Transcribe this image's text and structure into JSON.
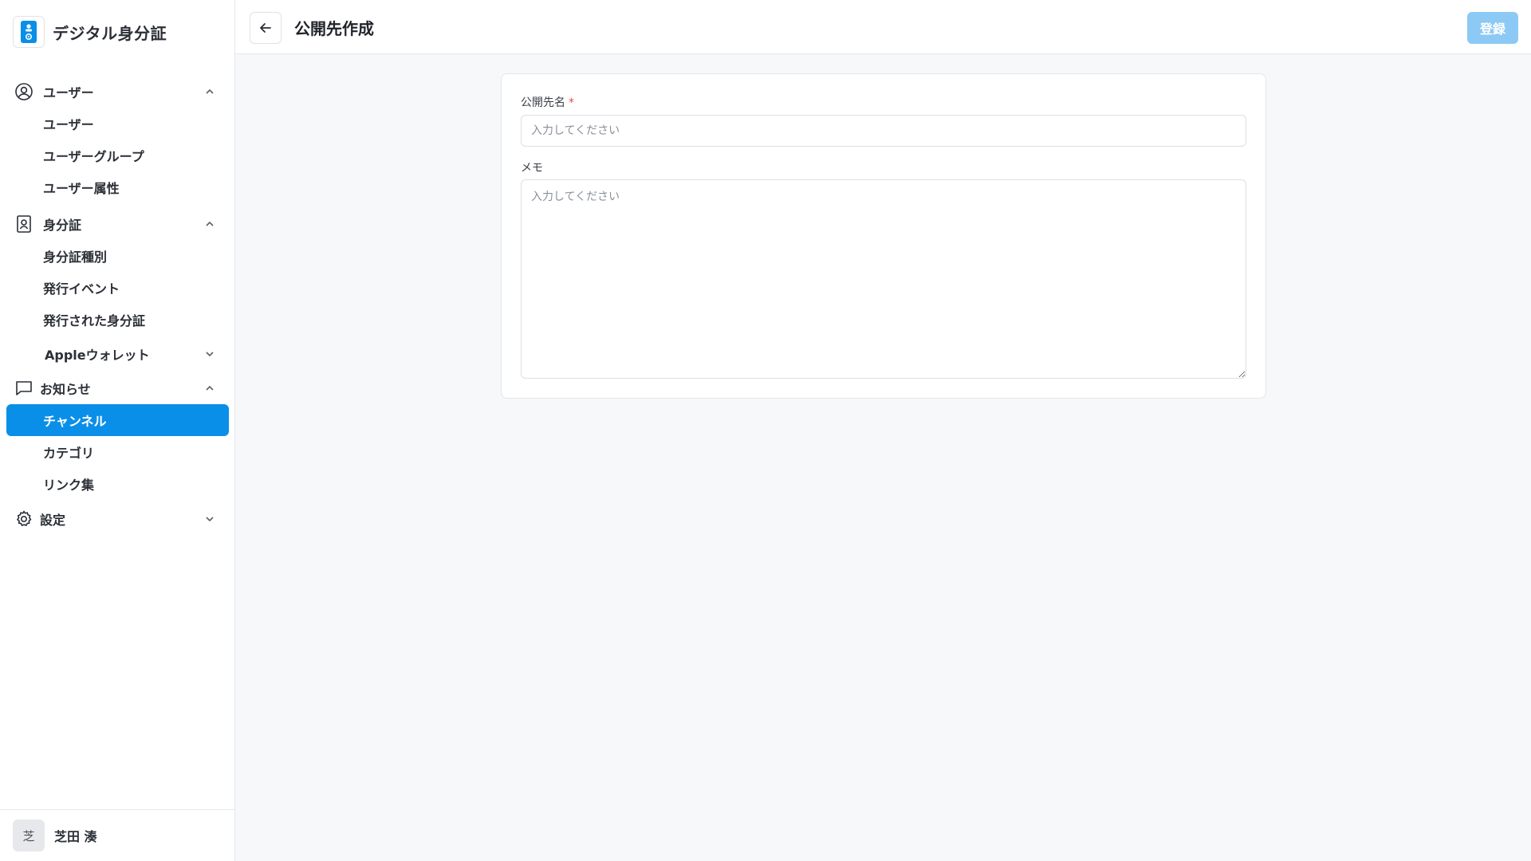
{
  "app": {
    "name": "デジタル身分証",
    "accent_color": "#0a8fe8"
  },
  "sidebar": {
    "groups": [
      {
        "label": "ユーザー",
        "icon": "user-circle-icon",
        "expanded": true,
        "items": [
          {
            "label": "ユーザー"
          },
          {
            "label": "ユーザーグループ"
          },
          {
            "label": "ユーザー属性"
          }
        ]
      },
      {
        "label": "身分証",
        "icon": "id-card-icon",
        "expanded": true,
        "items": [
          {
            "label": "身分証種別"
          },
          {
            "label": "発行イベント"
          },
          {
            "label": "発行された身分証"
          }
        ],
        "subgroups": [
          {
            "label": "Appleウォレット",
            "expanded": false
          }
        ]
      },
      {
        "label": "お知らせ",
        "icon": "chat-bubble-icon",
        "expanded": true,
        "items": [
          {
            "label": "チャンネル",
            "active": true
          },
          {
            "label": "カテゴリ"
          },
          {
            "label": "リンク集"
          }
        ]
      },
      {
        "label": "設定",
        "icon": "gear-icon",
        "expanded": false,
        "items": []
      }
    ],
    "user": {
      "avatar_text": "芝",
      "name": "芝田 湊"
    }
  },
  "header": {
    "title": "公開先作成",
    "register_label": "登録"
  },
  "form": {
    "name_field": {
      "label": "公開先名",
      "required_mark": "*",
      "placeholder": "入力してください",
      "value": ""
    },
    "memo_field": {
      "label": "メモ",
      "placeholder": "入力してください",
      "value": ""
    }
  }
}
